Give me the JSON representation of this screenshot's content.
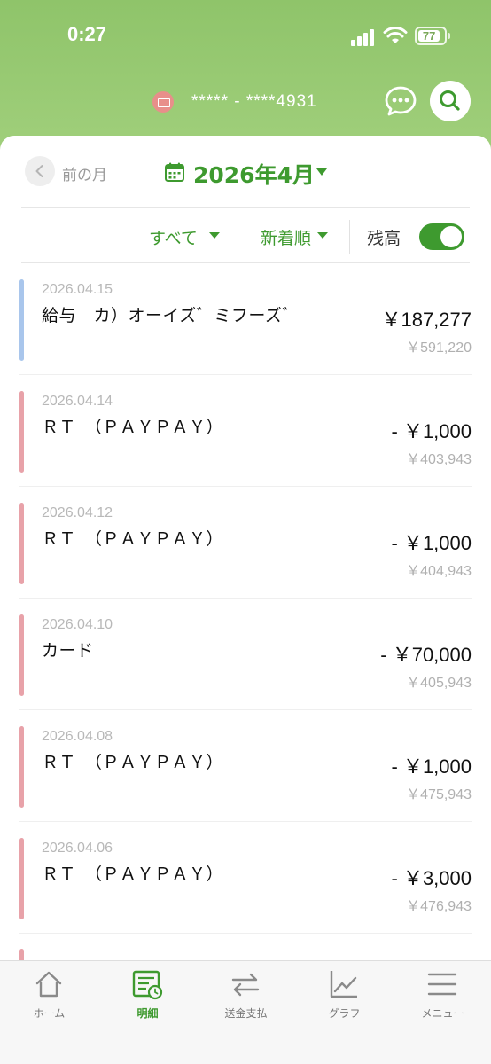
{
  "status": {
    "time": "0:27",
    "battery": "77"
  },
  "header": {
    "account_number": "***** - ****4931",
    "icons": {
      "chat": "chat-bubble-icon",
      "search": "search-icon",
      "account": "card-icon"
    }
  },
  "month_nav": {
    "prev_label": "前の月",
    "current_month": "2026年4月"
  },
  "filters": {
    "type": "すべて",
    "sort": "新着順",
    "balance_label": "残高",
    "balance_on": true
  },
  "colors": {
    "accent": "#3e9a2f",
    "header_green": "#a3d17e",
    "income_bar": "#a9c6ec",
    "expense_bar": "#e8a2a9"
  },
  "transactions": [
    {
      "date": "2026.04.15",
      "desc": "給与　カ）オーイズ゛ミフーズ゛",
      "amount": "￥187,277",
      "balance": "￥591,220",
      "kind": "income"
    },
    {
      "date": "2026.04.14",
      "desc": "ＲＴ　（ＰＡＹＰＡＹ）",
      "amount": "- ￥1,000",
      "balance": "￥403,943",
      "kind": "expense"
    },
    {
      "date": "2026.04.12",
      "desc": "ＲＴ　（ＰＡＹＰＡＹ）",
      "amount": "- ￥1,000",
      "balance": "￥404,943",
      "kind": "expense"
    },
    {
      "date": "2026.04.10",
      "desc": "カード",
      "amount": "- ￥70,000",
      "balance": "￥405,943",
      "kind": "expense"
    },
    {
      "date": "2026.04.08",
      "desc": "ＲＴ　（ＰＡＹＰＡＹ）",
      "amount": "- ￥1,000",
      "balance": "￥475,943",
      "kind": "expense"
    },
    {
      "date": "2026.04.06",
      "desc": "ＲＴ　（ＰＡＹＰＡＹ）",
      "amount": "- ￥3,000",
      "balance": "￥476,943",
      "kind": "expense"
    }
  ],
  "tabs": [
    {
      "label": "ホーム",
      "icon": "home-icon",
      "active": false
    },
    {
      "label": "明細",
      "icon": "statement-icon",
      "active": true
    },
    {
      "label": "送金支払",
      "icon": "transfer-icon",
      "active": false
    },
    {
      "label": "グラフ",
      "icon": "graph-icon",
      "active": false
    },
    {
      "label": "メニュー",
      "icon": "menu-icon",
      "active": false
    }
  ]
}
